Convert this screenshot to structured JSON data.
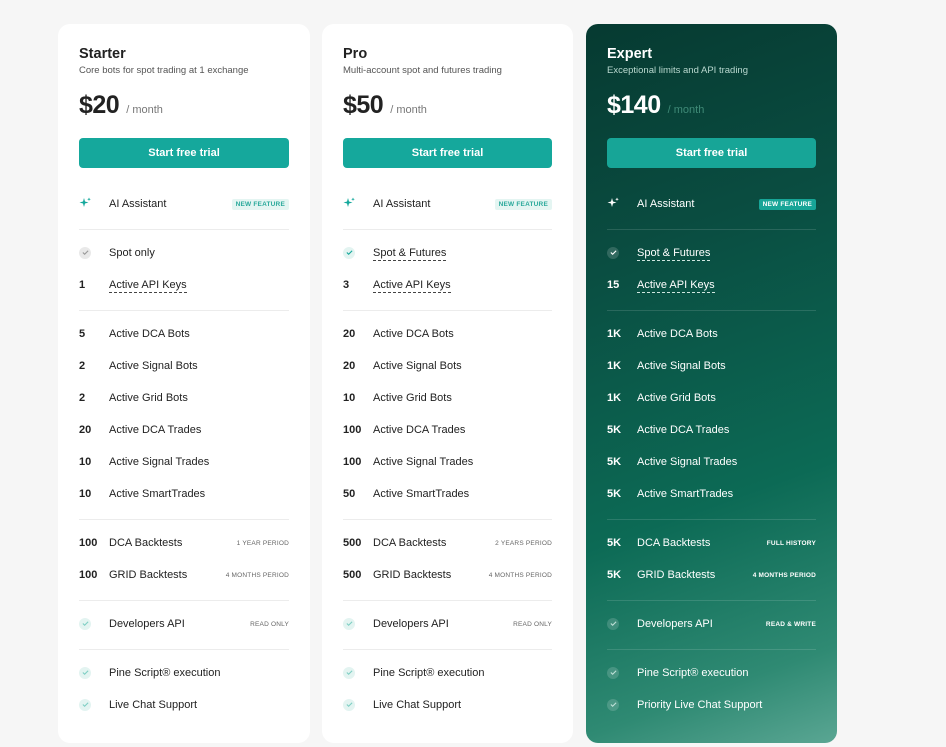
{
  "plans": [
    {
      "name": "Starter",
      "subtitle": "Core bots for spot trading at 1 exchange",
      "price": "$20",
      "period": "/ month",
      "cta": "Start free trial",
      "ai": {
        "label": "AI Assistant",
        "tag": "NEW FEATURE"
      },
      "trading_type": "Spot only",
      "api_keys": {
        "value": "1",
        "label": "Active API Keys"
      },
      "bots": [
        {
          "value": "5",
          "label": "Active DCA Bots"
        },
        {
          "value": "2",
          "label": "Active Signal Bots"
        },
        {
          "value": "2",
          "label": "Active Grid Bots"
        },
        {
          "value": "20",
          "label": "Active DCA Trades"
        },
        {
          "value": "10",
          "label": "Active Signal Trades"
        },
        {
          "value": "10",
          "label": "Active SmartTrades"
        }
      ],
      "backtests": [
        {
          "value": "100",
          "label": "DCA Backtests",
          "tag": "1 YEAR PERIOD"
        },
        {
          "value": "100",
          "label": "GRID Backtests",
          "tag": "4 MONTHS PERIOD"
        }
      ],
      "dev_api": {
        "label": "Developers API",
        "tag": "READ ONLY"
      },
      "extras": [
        "Pine Script® execution",
        "Live Chat Support"
      ]
    },
    {
      "name": "Pro",
      "subtitle": "Multi-account spot and futures trading",
      "price": "$50",
      "period": "/ month",
      "cta": "Start free trial",
      "ai": {
        "label": "AI Assistant",
        "tag": "NEW FEATURE"
      },
      "trading_type": "Spot & Futures",
      "api_keys": {
        "value": "3",
        "label": "Active API Keys"
      },
      "bots": [
        {
          "value": "20",
          "label": "Active DCA Bots"
        },
        {
          "value": "20",
          "label": "Active Signal Bots"
        },
        {
          "value": "10",
          "label": "Active Grid Bots"
        },
        {
          "value": "100",
          "label": "Active DCA Trades"
        },
        {
          "value": "100",
          "label": "Active Signal Trades"
        },
        {
          "value": "50",
          "label": "Active SmartTrades"
        }
      ],
      "backtests": [
        {
          "value": "500",
          "label": "DCA Backtests",
          "tag": "2 YEARS PERIOD"
        },
        {
          "value": "500",
          "label": "GRID Backtests",
          "tag": "4 MONTHS PERIOD"
        }
      ],
      "dev_api": {
        "label": "Developers API",
        "tag": "READ ONLY"
      },
      "extras": [
        "Pine Script® execution",
        "Live Chat Support"
      ]
    },
    {
      "name": "Expert",
      "subtitle": "Exceptional limits and API trading",
      "price": "$140",
      "period": "/ month",
      "cta": "Start free trial",
      "ai": {
        "label": "AI Assistant",
        "tag": "NEW FEATURE"
      },
      "trading_type": "Spot & Futures",
      "api_keys": {
        "value": "15",
        "label": "Active API Keys"
      },
      "bots": [
        {
          "value": "1K",
          "label": "Active DCA Bots"
        },
        {
          "value": "1K",
          "label": "Active Signal Bots"
        },
        {
          "value": "1K",
          "label": "Active Grid Bots"
        },
        {
          "value": "5K",
          "label": "Active DCA Trades"
        },
        {
          "value": "5K",
          "label": "Active Signal Trades"
        },
        {
          "value": "5K",
          "label": "Active SmartTrades"
        }
      ],
      "backtests": [
        {
          "value": "5K",
          "label": "DCA Backtests",
          "tag": "FULL HISTORY"
        },
        {
          "value": "5K",
          "label": "GRID Backtests",
          "tag": "4 MONTHS PERIOD"
        }
      ],
      "dev_api": {
        "label": "Developers API",
        "tag": "READ & WRITE"
      },
      "extras": [
        "Pine Script® execution",
        "Priority Live Chat Support"
      ]
    }
  ],
  "icons": {
    "ai": "sparkle-icon",
    "check": "check-icon"
  },
  "colors": {
    "accent": "#15a89c",
    "expert_bg": "#0a4d41"
  }
}
